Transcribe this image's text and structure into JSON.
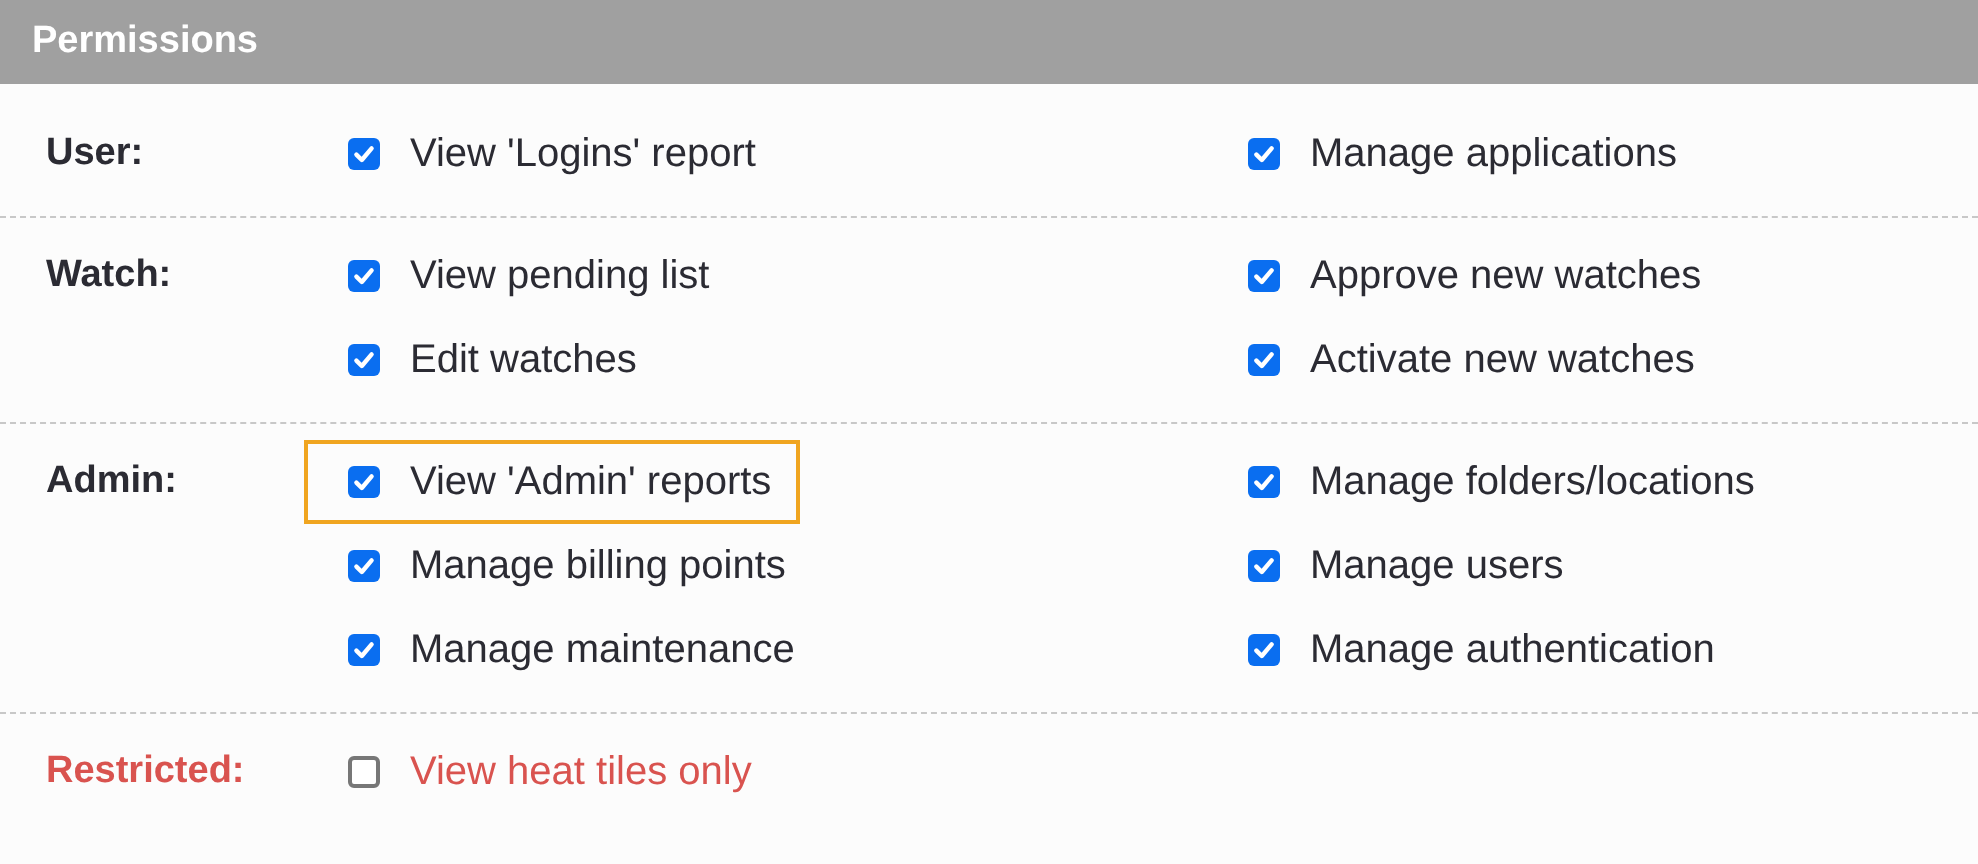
{
  "panel": {
    "title": "Permissions"
  },
  "groups": [
    {
      "label": "User:",
      "kind": "normal",
      "items": [
        {
          "label": "View 'Logins' report",
          "checked": true,
          "highlighted": false
        },
        {
          "label": "Manage applications",
          "checked": true,
          "highlighted": false
        }
      ]
    },
    {
      "label": "Watch:",
      "kind": "normal",
      "items": [
        {
          "label": "View pending list",
          "checked": true,
          "highlighted": false
        },
        {
          "label": "Approve new watches",
          "checked": true,
          "highlighted": false
        },
        {
          "label": "Edit watches",
          "checked": true,
          "highlighted": false
        },
        {
          "label": "Activate new watches",
          "checked": true,
          "highlighted": false
        }
      ]
    },
    {
      "label": "Admin:",
      "kind": "normal",
      "items": [
        {
          "label": "View 'Admin' reports",
          "checked": true,
          "highlighted": true
        },
        {
          "label": "Manage folders/locations",
          "checked": true,
          "highlighted": false
        },
        {
          "label": "Manage billing points",
          "checked": true,
          "highlighted": false
        },
        {
          "label": "Manage users",
          "checked": true,
          "highlighted": false
        },
        {
          "label": "Manage maintenance",
          "checked": true,
          "highlighted": false
        },
        {
          "label": "Manage authentication",
          "checked": true,
          "highlighted": false
        }
      ]
    },
    {
      "label": "Restricted:",
      "kind": "restricted",
      "items": [
        {
          "label": "View heat tiles only",
          "checked": false,
          "highlighted": false
        }
      ]
    }
  ]
}
